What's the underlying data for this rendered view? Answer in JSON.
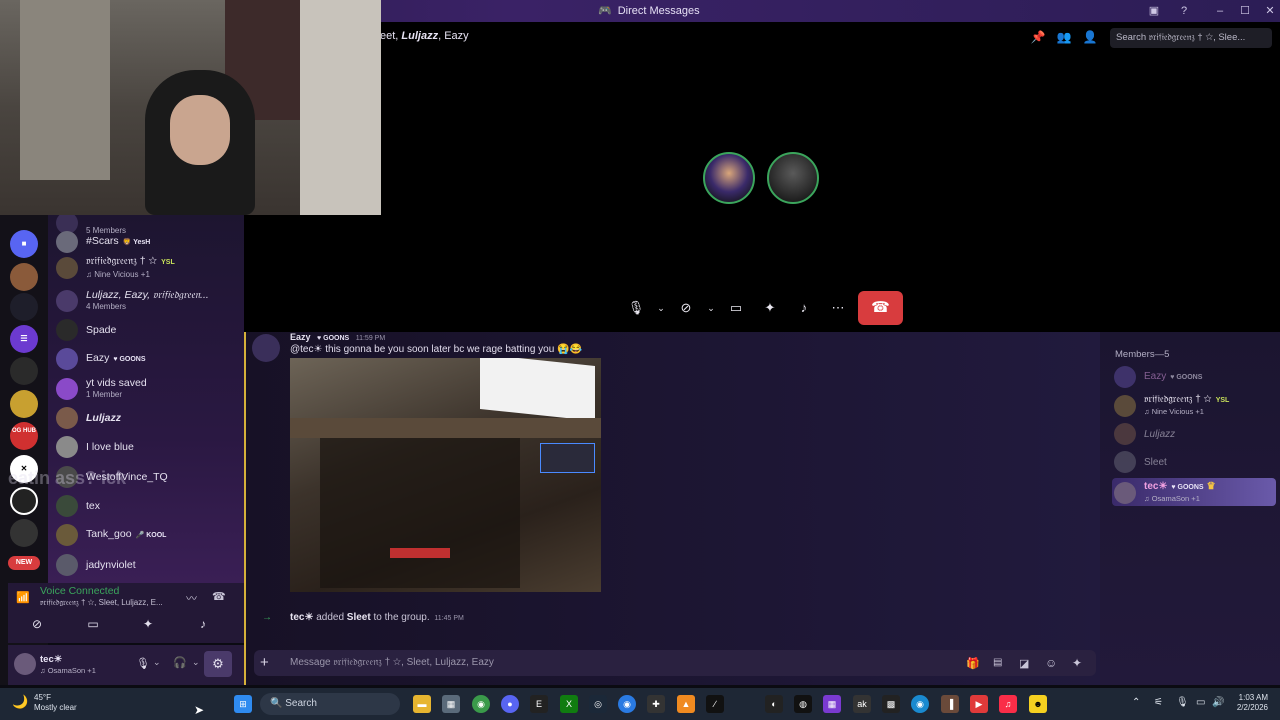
{
  "titlebar": {
    "title": "Direct Messages"
  },
  "call": {
    "header_prefix": "eet,",
    "header_italic": "Luljazz",
    "header_suffix": ", Eazy",
    "search_placeholder": "Search 𝔳𝔯𝔦𝔣𝔦𝔢𝔡𝔤𝔯𝔢𝔢𝔫𝔷 † ☆, Slee..."
  },
  "dm_list": [
    {
      "name": "5 Members",
      "sub": "",
      "tag": ""
    },
    {
      "name": "#Scars",
      "sub": "",
      "tag": "🦁 YesH"
    },
    {
      "name": "𝔳𝔯𝔦𝔣𝔦𝔢𝔡𝔤𝔯𝔢𝔢𝔫𝔷 † ☆",
      "sub": "♫ Nine Vicious +1",
      "tag": "YSL"
    },
    {
      "name": "Luljazz, Eazy, 𝔳𝔯𝔦𝔣𝔦𝔢𝔡𝔤𝔯𝔢𝔢𝔫...",
      "sub": "4 Members",
      "tag": ""
    },
    {
      "name": "Spade",
      "sub": "",
      "tag": ""
    },
    {
      "name": "Eazy",
      "sub": "",
      "tag": "♥ GOONS"
    },
    {
      "name": "yt vids saved",
      "sub": "1 Member",
      "tag": ""
    },
    {
      "name": "Luljazz",
      "sub": "",
      "tag": ""
    },
    {
      "name": "I love blue",
      "sub": "",
      "tag": ""
    },
    {
      "name": "WestoffVince_TQ",
      "sub": "",
      "tag": ""
    },
    {
      "name": "tex",
      "sub": "",
      "tag": ""
    },
    {
      "name": "Tank_goo",
      "sub": "",
      "tag": "🎤 KOOL"
    },
    {
      "name": "jadynviolet",
      "sub": "",
      "tag": ""
    }
  ],
  "voice": {
    "title": "Voice Connected",
    "sub": "𝔳𝔯𝔦𝔣𝔦𝔢𝔡𝔤𝔯𝔢𝔢𝔫𝔷 † ☆, Sleet, Luljazz, E..."
  },
  "user": {
    "name": "tec☀",
    "sub": "♫ OsamaSon +1"
  },
  "chat": {
    "msg_author": "Eazy",
    "msg_badge": "♥ GOONS",
    "msg_time": "11:59 PM",
    "msg_text": "@tec☀  this gonna be you soon later bc we rage batting you 😭😂",
    "sys_actor": "tec☀",
    "sys_mid": " added ",
    "sys_target": "Sleet",
    "sys_end": " to the group.",
    "sys_time": "11:45 PM",
    "placeholder": "Message 𝔳𝔯𝔦𝔣𝔦𝔢𝔡𝔤𝔯𝔢𝔢𝔫𝔷 † ☆, Sleet, Luljazz, Eazy"
  },
  "members": {
    "title": "Members—5",
    "items": [
      {
        "name": "Eazy",
        "sub": "",
        "tag": "♥ GOONS"
      },
      {
        "name": "𝔳𝔯𝔦𝔣𝔦𝔢𝔡𝔤𝔯𝔢𝔢𝔫𝔷 † ☆",
        "sub": "♫ Nine Vicious +1",
        "tag": "YSL"
      },
      {
        "name": "Luljazz",
        "sub": "",
        "tag": ""
      },
      {
        "name": "Sleet",
        "sub": "",
        "tag": ""
      },
      {
        "name": "tec☀",
        "sub": "♫ OsamaSon +1",
        "tag": "♥ GOONS"
      }
    ]
  },
  "overlay_text": "eatin ass? ick",
  "taskbar": {
    "weather_temp": "45°F",
    "weather_desc": "Mostly clear",
    "search": "Search",
    "time": "1:03 AM",
    "date": "2/2/2026"
  },
  "rail_new": "NEW",
  "rail_oghub": "OG HUB"
}
